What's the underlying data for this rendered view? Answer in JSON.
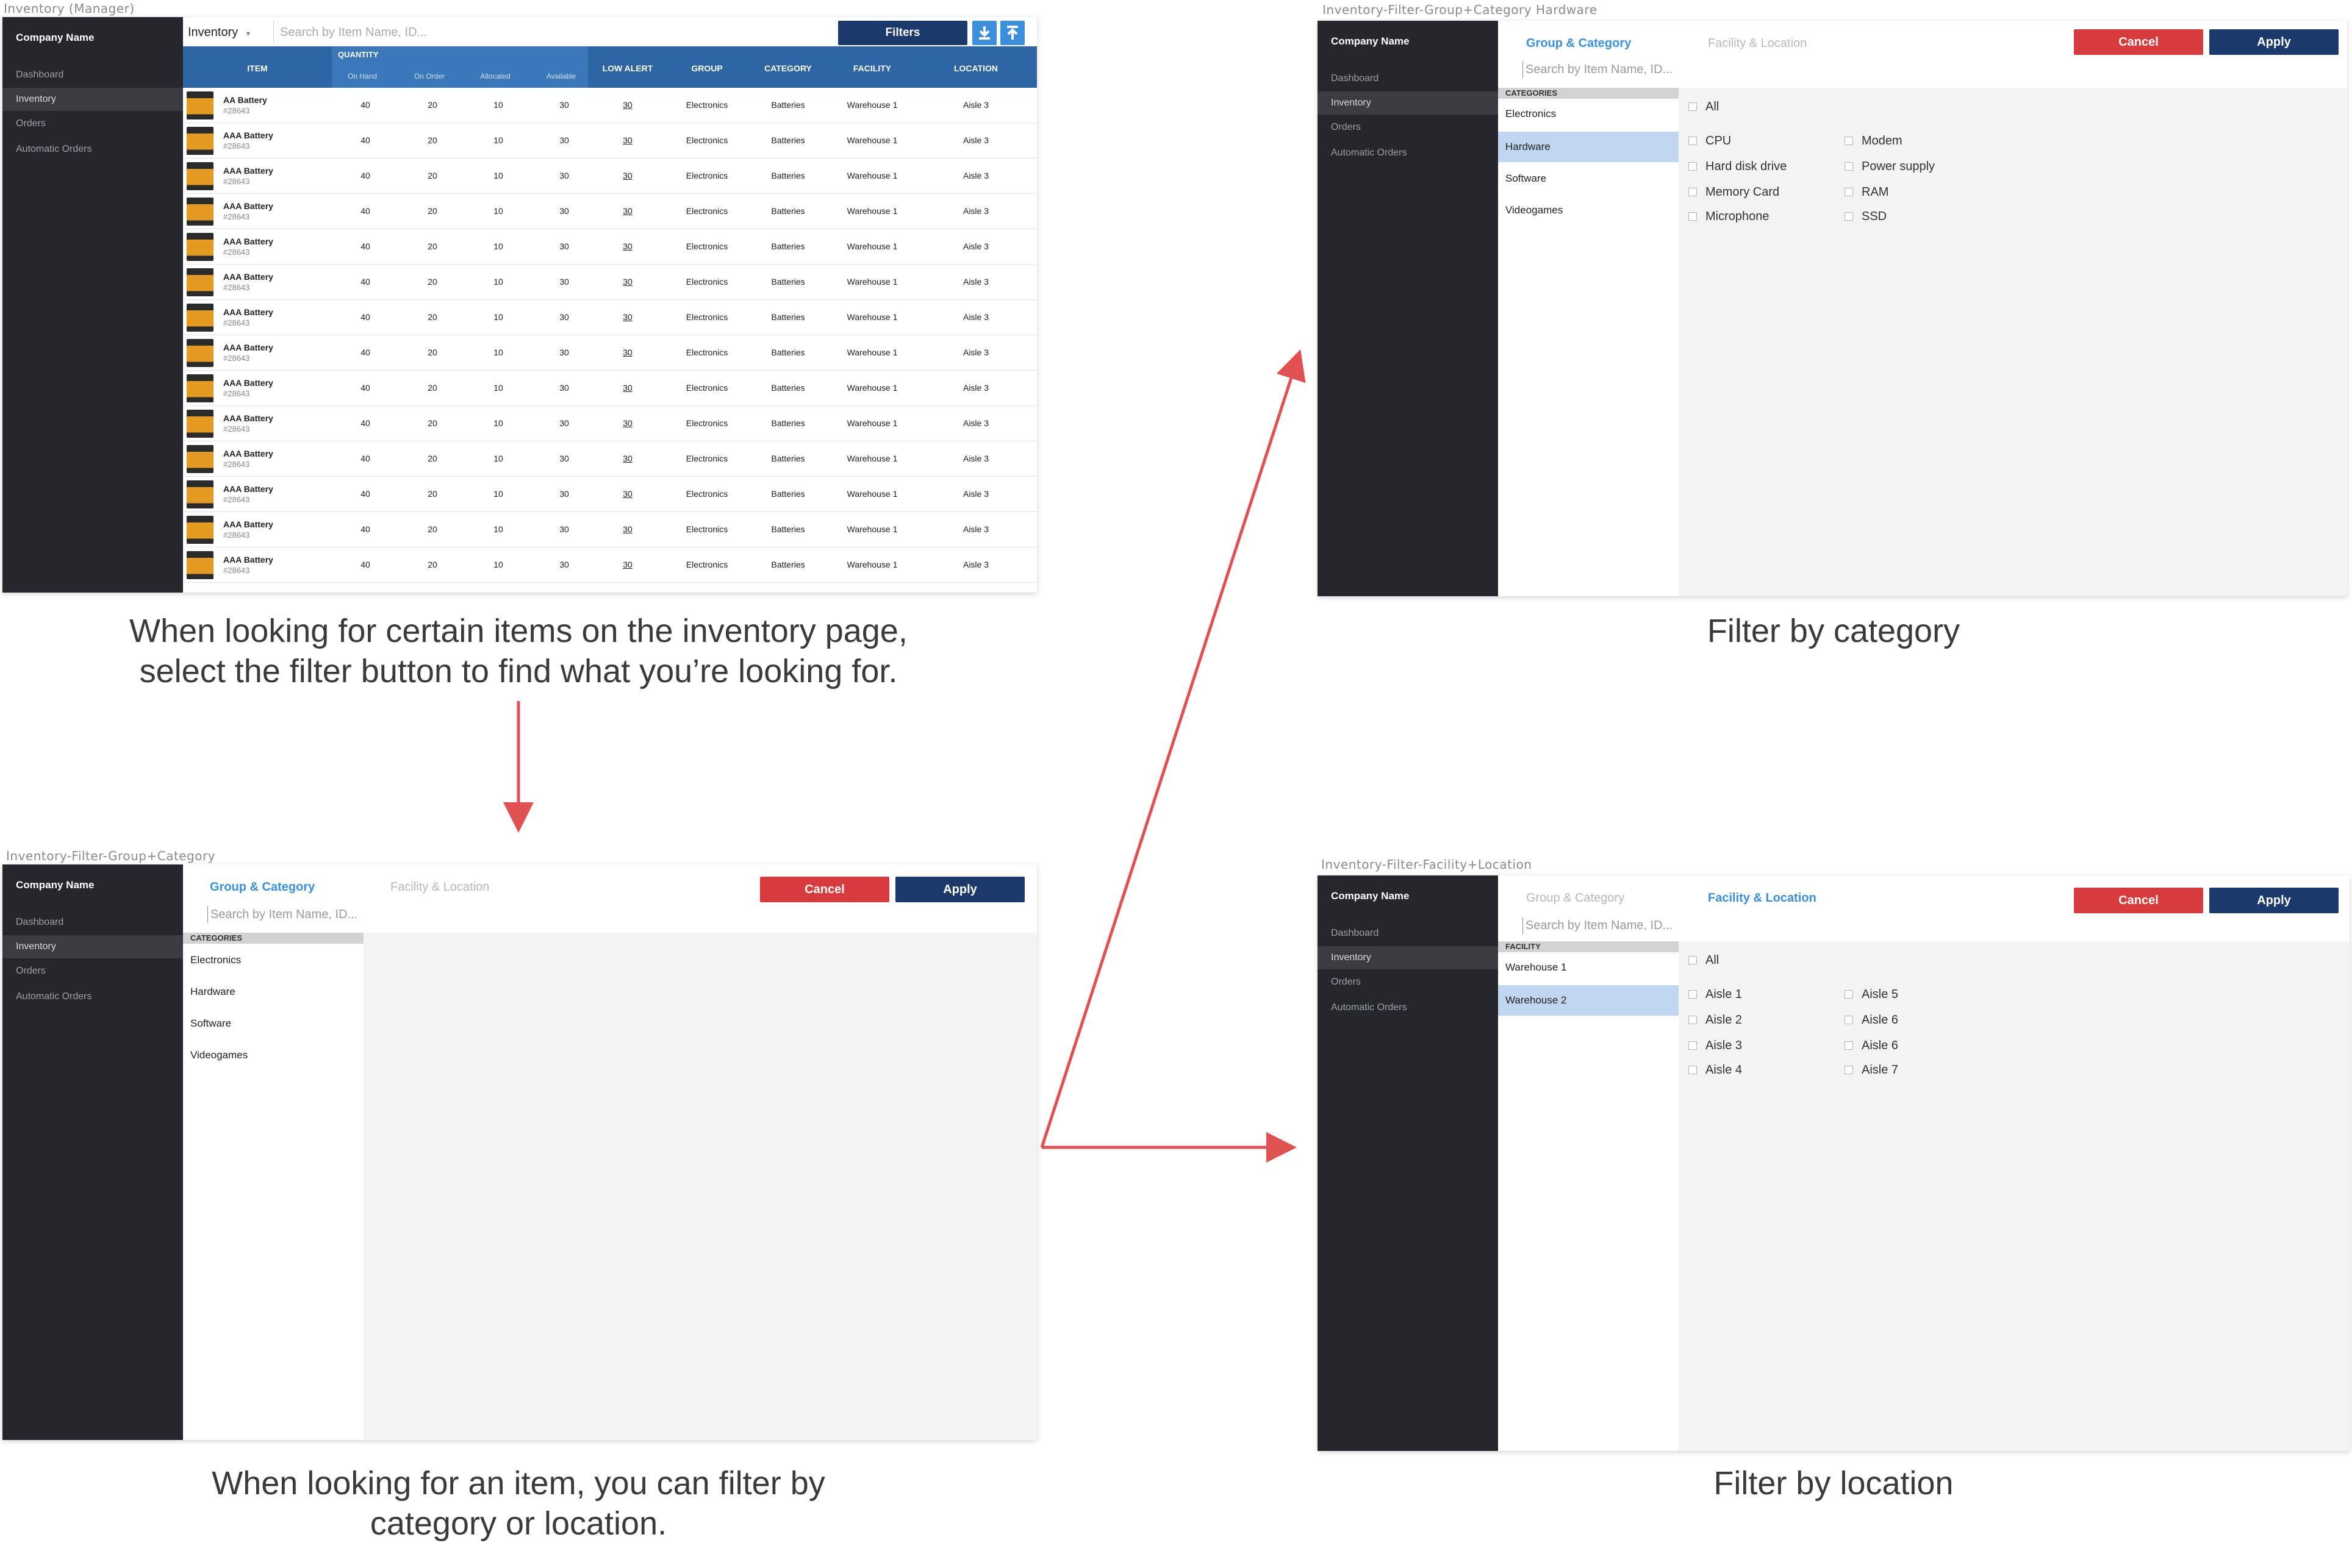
{
  "sidebar": {
    "company": "Company Name",
    "items": [
      "Dashboard",
      "Inventory",
      "Orders",
      "Automatic Orders"
    ]
  },
  "frames": {
    "inventory": {
      "label": "Inventory (Manager)",
      "select_label": "Inventory",
      "search_placeholder": "Search by Item Name, ID...",
      "filters_label": "Filters",
      "headers": {
        "item": "ITEM",
        "quantity": "QUANTITY",
        "sub": [
          "On Hand",
          "On Order",
          "Allocated",
          "Available"
        ],
        "low_alert": "LOW ALERT",
        "group": "GROUP",
        "category": "CATEGORY",
        "facility": "FACILITY",
        "location": "LOCATION"
      },
      "rows": [
        {
          "name": "AA Battery",
          "id": "#28643",
          "on_hand": "40",
          "on_order": "20",
          "allocated": "10",
          "available": "30",
          "low_alert": "30",
          "group": "Electronics",
          "category": "Batteries",
          "facility": "Warehouse 1",
          "location": "Aisle 3"
        },
        {
          "name": "AAA Battery",
          "id": "#28643",
          "on_hand": "40",
          "on_order": "20",
          "allocated": "10",
          "available": "30",
          "low_alert": "30",
          "group": "Electronics",
          "category": "Batteries",
          "facility": "Warehouse 1",
          "location": "Aisle 3"
        },
        {
          "name": "AAA Battery",
          "id": "#28643",
          "on_hand": "40",
          "on_order": "20",
          "allocated": "10",
          "available": "30",
          "low_alert": "30",
          "group": "Electronics",
          "category": "Batteries",
          "facility": "Warehouse 1",
          "location": "Aisle 3"
        },
        {
          "name": "AAA Battery",
          "id": "#28643",
          "on_hand": "40",
          "on_order": "20",
          "allocated": "10",
          "available": "30",
          "low_alert": "30",
          "group": "Electronics",
          "category": "Batteries",
          "facility": "Warehouse 1",
          "location": "Aisle 3"
        },
        {
          "name": "AAA Battery",
          "id": "#28643",
          "on_hand": "40",
          "on_order": "20",
          "allocated": "10",
          "available": "30",
          "low_alert": "30",
          "group": "Electronics",
          "category": "Batteries",
          "facility": "Warehouse 1",
          "location": "Aisle 3"
        },
        {
          "name": "AAA Battery",
          "id": "#28643",
          "on_hand": "40",
          "on_order": "20",
          "allocated": "10",
          "available": "30",
          "low_alert": "30",
          "group": "Electronics",
          "category": "Batteries",
          "facility": "Warehouse 1",
          "location": "Aisle 3"
        },
        {
          "name": "AAA Battery",
          "id": "#28643",
          "on_hand": "40",
          "on_order": "20",
          "allocated": "10",
          "available": "30",
          "low_alert": "30",
          "group": "Electronics",
          "category": "Batteries",
          "facility": "Warehouse 1",
          "location": "Aisle 3"
        },
        {
          "name": "AAA Battery",
          "id": "#28643",
          "on_hand": "40",
          "on_order": "20",
          "allocated": "10",
          "available": "30",
          "low_alert": "30",
          "group": "Electronics",
          "category": "Batteries",
          "facility": "Warehouse 1",
          "location": "Aisle 3"
        },
        {
          "name": "AAA Battery",
          "id": "#28643",
          "on_hand": "40",
          "on_order": "20",
          "allocated": "10",
          "available": "30",
          "low_alert": "30",
          "group": "Electronics",
          "category": "Batteries",
          "facility": "Warehouse 1",
          "location": "Aisle 3"
        },
        {
          "name": "AAA Battery",
          "id": "#28643",
          "on_hand": "40",
          "on_order": "20",
          "allocated": "10",
          "available": "30",
          "low_alert": "30",
          "group": "Electronics",
          "category": "Batteries",
          "facility": "Warehouse 1",
          "location": "Aisle 3"
        },
        {
          "name": "AAA Battery",
          "id": "#28643",
          "on_hand": "40",
          "on_order": "20",
          "allocated": "10",
          "available": "30",
          "low_alert": "30",
          "group": "Electronics",
          "category": "Batteries",
          "facility": "Warehouse 1",
          "location": "Aisle 3"
        },
        {
          "name": "AAA Battery",
          "id": "#28643",
          "on_hand": "40",
          "on_order": "20",
          "allocated": "10",
          "available": "30",
          "low_alert": "30",
          "group": "Electronics",
          "category": "Batteries",
          "facility": "Warehouse 1",
          "location": "Aisle 3"
        },
        {
          "name": "AAA Battery",
          "id": "#28643",
          "on_hand": "40",
          "on_order": "20",
          "allocated": "10",
          "available": "30",
          "low_alert": "30",
          "group": "Electronics",
          "category": "Batteries",
          "facility": "Warehouse 1",
          "location": "Aisle 3"
        },
        {
          "name": "AAA Battery",
          "id": "#28643",
          "on_hand": "40",
          "on_order": "20",
          "allocated": "10",
          "available": "30",
          "low_alert": "30",
          "group": "Electronics",
          "category": "Batteries",
          "facility": "Warehouse 1",
          "location": "Aisle 3"
        }
      ],
      "caption": [
        "When looking for certain items on the inventory page,",
        "select the filter button to find what you’re looking for."
      ]
    },
    "filter_group": {
      "label": "Inventory-Filter-Group+Category",
      "tab_group": "Group & Category",
      "tab_facility": "Facility & Location",
      "cancel": "Cancel",
      "apply": "Apply",
      "search_placeholder": "Search by Item Name, ID...",
      "list_head": "CATEGORIES",
      "list": [
        "Electronics",
        "Hardware",
        "Software",
        "Videogames"
      ],
      "caption": [
        "When looking for an item, you can filter by",
        "category or location."
      ]
    },
    "filter_hardware": {
      "label": "Inventory-Filter-Group+Category Hardware",
      "list_head": "CATEGORIES",
      "list": [
        "Electronics",
        "Hardware",
        "Software",
        "Videogames"
      ],
      "all": "All",
      "options_left": [
        "CPU",
        "Hard disk drive",
        "Memory Card",
        "Microphone"
      ],
      "options_right": [
        "Modem",
        "Power supply",
        "RAM",
        "SSD"
      ],
      "caption": "Filter by category"
    },
    "filter_location": {
      "label": "Inventory-Filter-Facility+Location",
      "list_head": "FACILITY",
      "list": [
        "Warehouse 1",
        "Warehouse 2"
      ],
      "all": "All",
      "options_left": [
        "Aisle 1",
        "Aisle 2",
        "Aisle 3",
        "Aisle 4"
      ],
      "options_right": [
        "Aisle 5",
        "Aisle 6",
        "Aisle 6",
        "Aisle 7"
      ],
      "caption": "Filter by location"
    }
  },
  "colors": {
    "sidebar": "#26272c",
    "header_blue": "#2e66a3",
    "accent_blue": "#3c8fdc",
    "navy": "#1b3a6b",
    "cancel_red": "#d83b3b",
    "arrow_red": "#e05252",
    "selected_row": "#c0d5ee"
  },
  "icons": [
    "download-icon",
    "upload-icon",
    "chevron-down-icon",
    "checkbox-icon",
    "arrow-icon"
  ]
}
